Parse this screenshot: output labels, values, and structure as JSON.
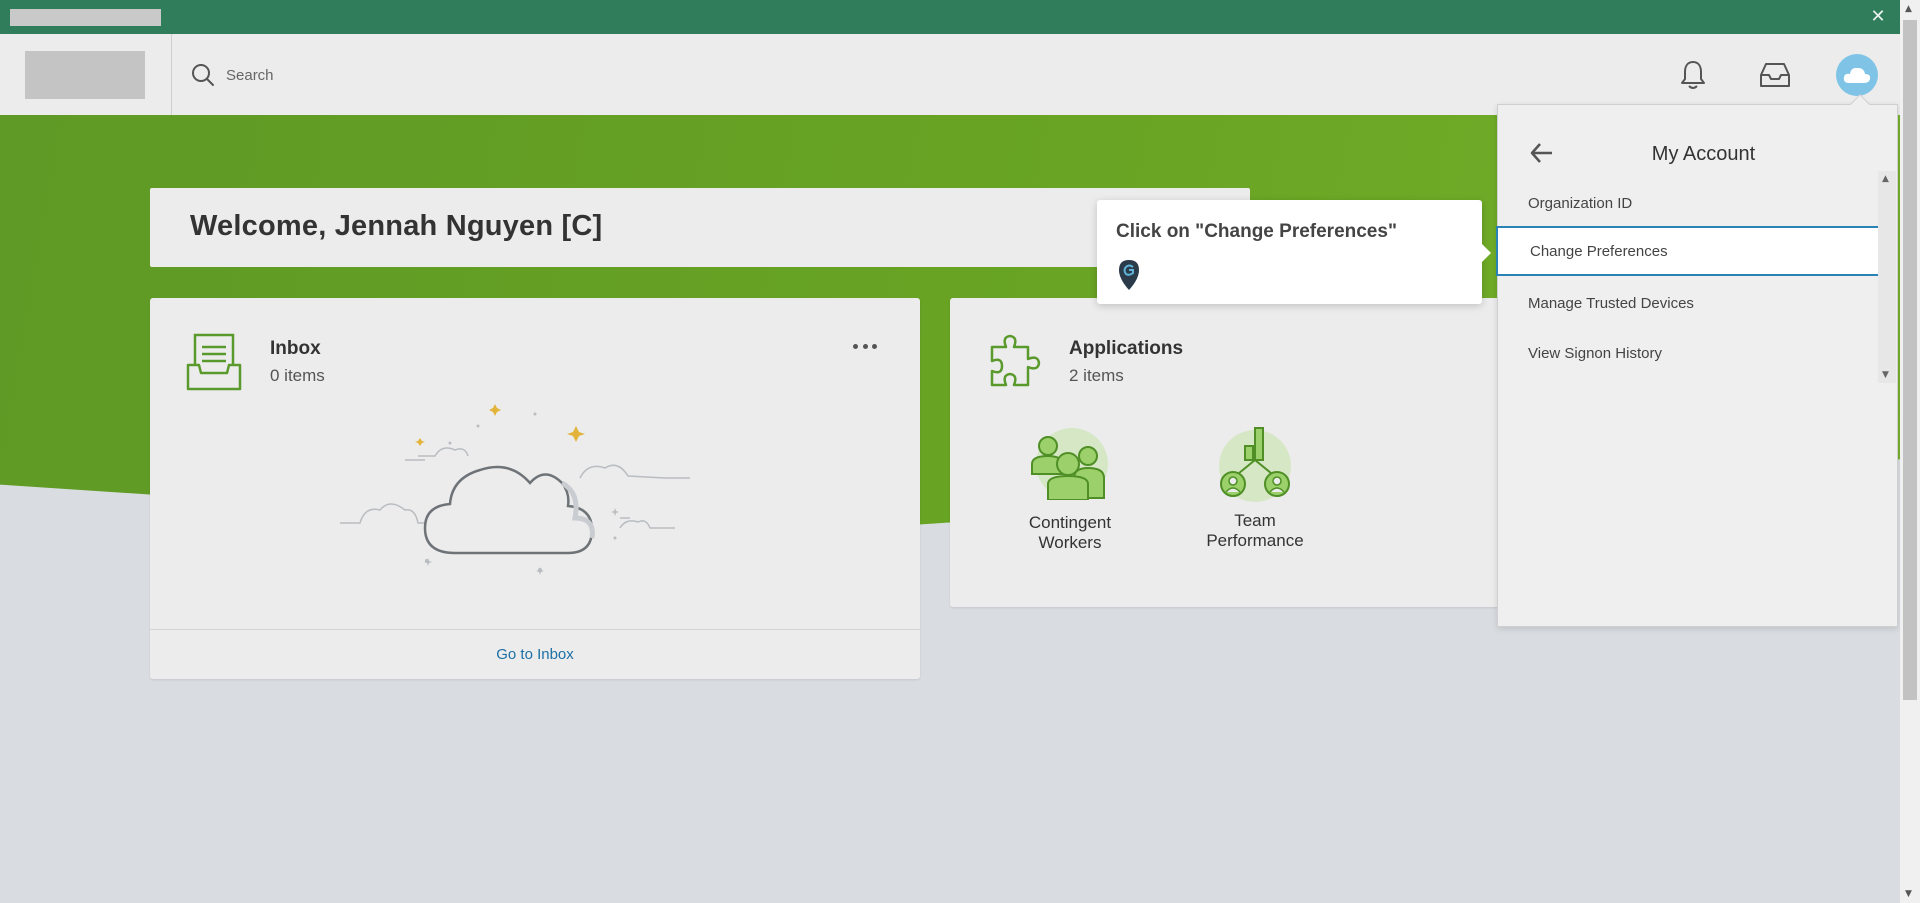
{
  "window": {
    "close_glyph": "✕"
  },
  "header": {
    "search_placeholder": "Search",
    "icons": [
      "search-icon",
      "bell-icon",
      "inbox-tray-icon",
      "cloud-avatar-icon"
    ]
  },
  "welcome": {
    "text": "Welcome, Jennah Nguyen [C]"
  },
  "inbox_card": {
    "title": "Inbox",
    "count": "0 items",
    "footer_link": "Go to Inbox"
  },
  "apps_card": {
    "title": "Applications",
    "count": "2 items",
    "apps": [
      {
        "line1": "Contingent",
        "line2": "Workers"
      },
      {
        "line1": "Team",
        "line2": "Performance"
      }
    ]
  },
  "tooltip": {
    "text": "Click on \"Change Preferences\""
  },
  "account_menu": {
    "title": "My Account",
    "items": [
      "Organization ID",
      "Change Preferences",
      "Manage Trusted Devices",
      "View Signon History"
    ],
    "selected_item": "Change Preferences"
  },
  "colors": {
    "top_bar": "#2f7d5b",
    "hero_green": "#6aa524",
    "icon_green": "#5a9a2c",
    "link_blue": "#1d6fa5",
    "selection_blue": "#2b82b4",
    "avatar_blue": "#7fc4e6"
  }
}
